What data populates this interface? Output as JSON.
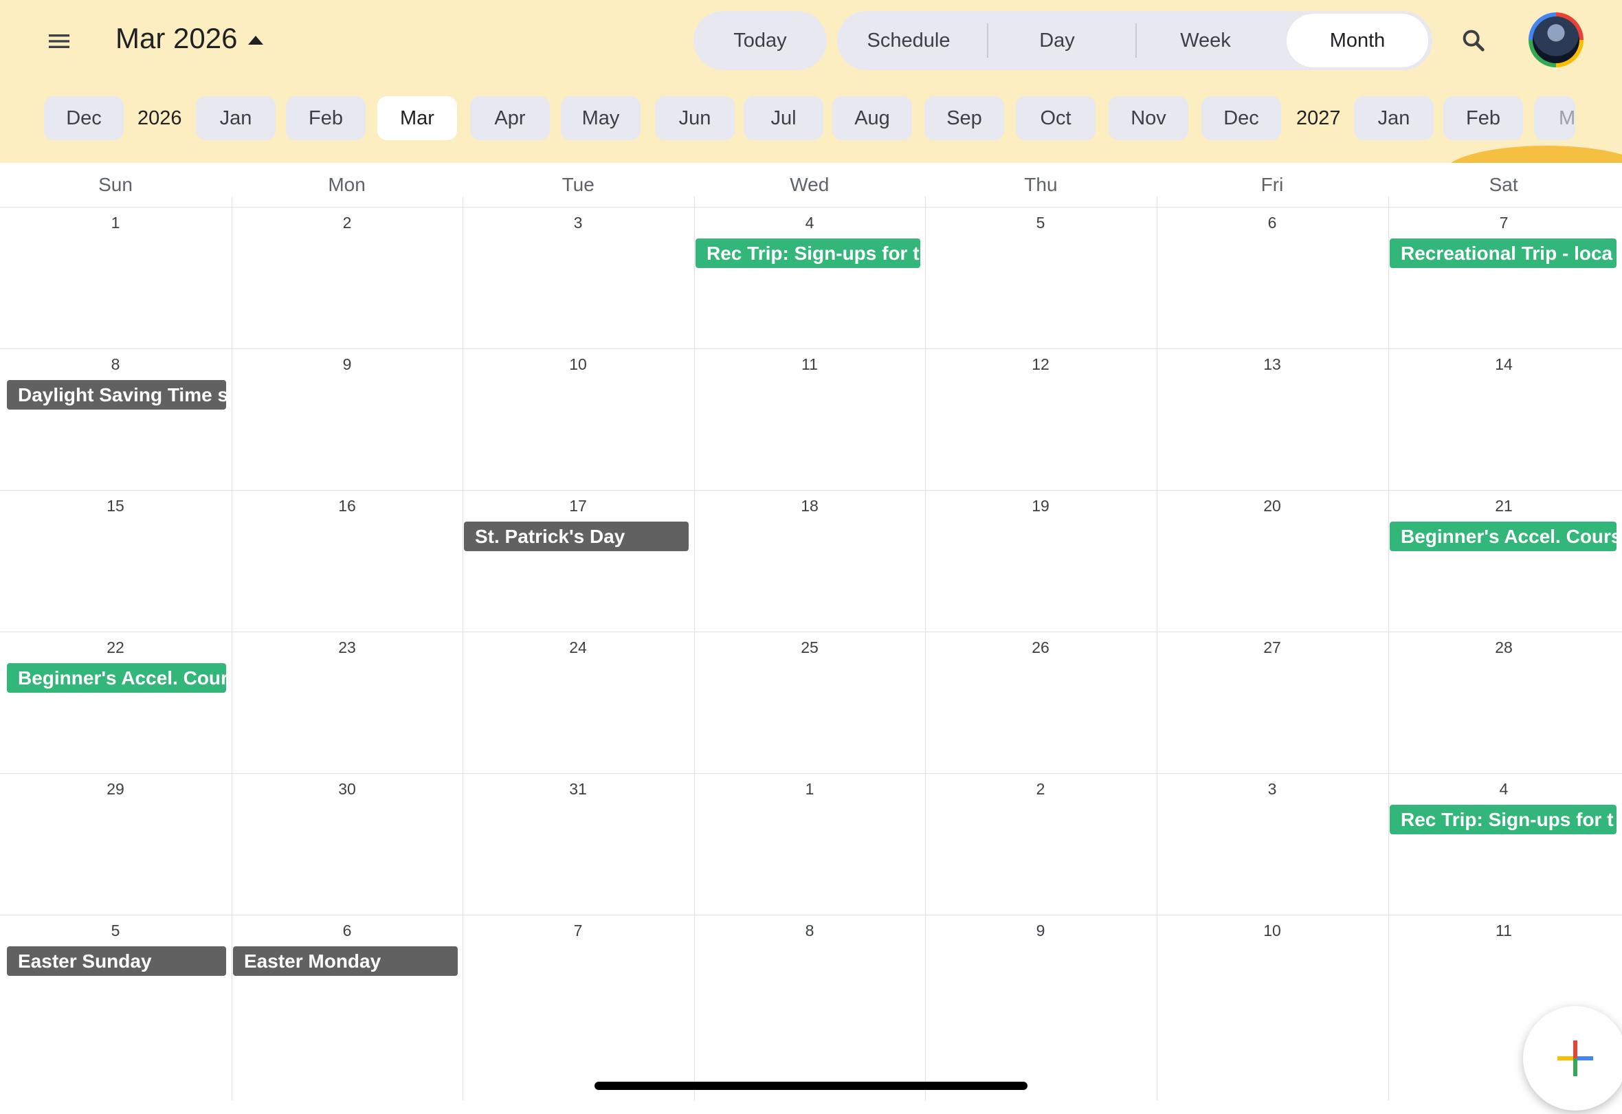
{
  "header": {
    "title": "Mar 2026",
    "today_label": "Today",
    "views": [
      "Schedule",
      "Day",
      "Week",
      "Month"
    ],
    "active_view": "Month"
  },
  "month_strip": {
    "items": [
      {
        "kind": "chip",
        "label": "Dec"
      },
      {
        "kind": "year",
        "label": "2026"
      },
      {
        "kind": "chip",
        "label": "Jan"
      },
      {
        "kind": "chip",
        "label": "Feb"
      },
      {
        "kind": "chip",
        "label": "Mar",
        "active": true
      },
      {
        "kind": "chip",
        "label": "Apr"
      },
      {
        "kind": "chip",
        "label": "May"
      },
      {
        "kind": "chip",
        "label": "Jun"
      },
      {
        "kind": "chip",
        "label": "Jul"
      },
      {
        "kind": "chip",
        "label": "Aug"
      },
      {
        "kind": "chip",
        "label": "Sep"
      },
      {
        "kind": "chip",
        "label": "Oct"
      },
      {
        "kind": "chip",
        "label": "Nov"
      },
      {
        "kind": "chip",
        "label": "Dec"
      },
      {
        "kind": "year",
        "label": "2027"
      },
      {
        "kind": "chip",
        "label": "Jan"
      },
      {
        "kind": "chip",
        "label": "Feb"
      },
      {
        "kind": "chip",
        "label": "M"
      }
    ]
  },
  "weekdays": [
    "Sun",
    "Mon",
    "Tue",
    "Wed",
    "Thu",
    "Fri",
    "Sat"
  ],
  "weeks": [
    [
      {
        "day": "1"
      },
      {
        "day": "2"
      },
      {
        "day": "3"
      },
      {
        "day": "4",
        "events": [
          {
            "title": "Rec Trip: Sign-ups for t",
            "color": "green"
          }
        ]
      },
      {
        "day": "5"
      },
      {
        "day": "6"
      },
      {
        "day": "7",
        "events": [
          {
            "title": "Recreational Trip - loca",
            "color": "green"
          }
        ]
      }
    ],
    [
      {
        "day": "8",
        "events": [
          {
            "title": "Daylight Saving Time s",
            "color": "gray"
          }
        ]
      },
      {
        "day": "9"
      },
      {
        "day": "10"
      },
      {
        "day": "11"
      },
      {
        "day": "12"
      },
      {
        "day": "13"
      },
      {
        "day": "14"
      }
    ],
    [
      {
        "day": "15"
      },
      {
        "day": "16"
      },
      {
        "day": "17",
        "events": [
          {
            "title": "St. Patrick's Day",
            "color": "gray"
          }
        ]
      },
      {
        "day": "18"
      },
      {
        "day": "19"
      },
      {
        "day": "20"
      },
      {
        "day": "21",
        "events": [
          {
            "title": "Beginner's Accel. Cours",
            "color": "green"
          }
        ]
      }
    ],
    [
      {
        "day": "22",
        "events": [
          {
            "title": "Beginner's Accel. Cour",
            "color": "green"
          }
        ]
      },
      {
        "day": "23"
      },
      {
        "day": "24"
      },
      {
        "day": "25"
      },
      {
        "day": "26"
      },
      {
        "day": "27"
      },
      {
        "day": "28"
      }
    ],
    [
      {
        "day": "29"
      },
      {
        "day": "30"
      },
      {
        "day": "31"
      },
      {
        "day": "1"
      },
      {
        "day": "2"
      },
      {
        "day": "3"
      },
      {
        "day": "4",
        "events": [
          {
            "title": "Rec Trip: Sign-ups for t",
            "color": "green"
          }
        ]
      }
    ],
    [
      {
        "day": "5",
        "events": [
          {
            "title": "Easter Sunday",
            "color": "gray"
          }
        ]
      },
      {
        "day": "6",
        "events": [
          {
            "title": "Easter Monday",
            "color": "gray"
          }
        ]
      },
      {
        "day": "7"
      },
      {
        "day": "8"
      },
      {
        "day": "9"
      },
      {
        "day": "10"
      },
      {
        "day": "11"
      }
    ]
  ],
  "colors": {
    "header_bg": "#fdeec2",
    "event_green": "#33b679",
    "event_gray": "#616161"
  },
  "icons": {
    "menu": "menu-icon",
    "search": "search-icon",
    "fab": "add-icon"
  }
}
